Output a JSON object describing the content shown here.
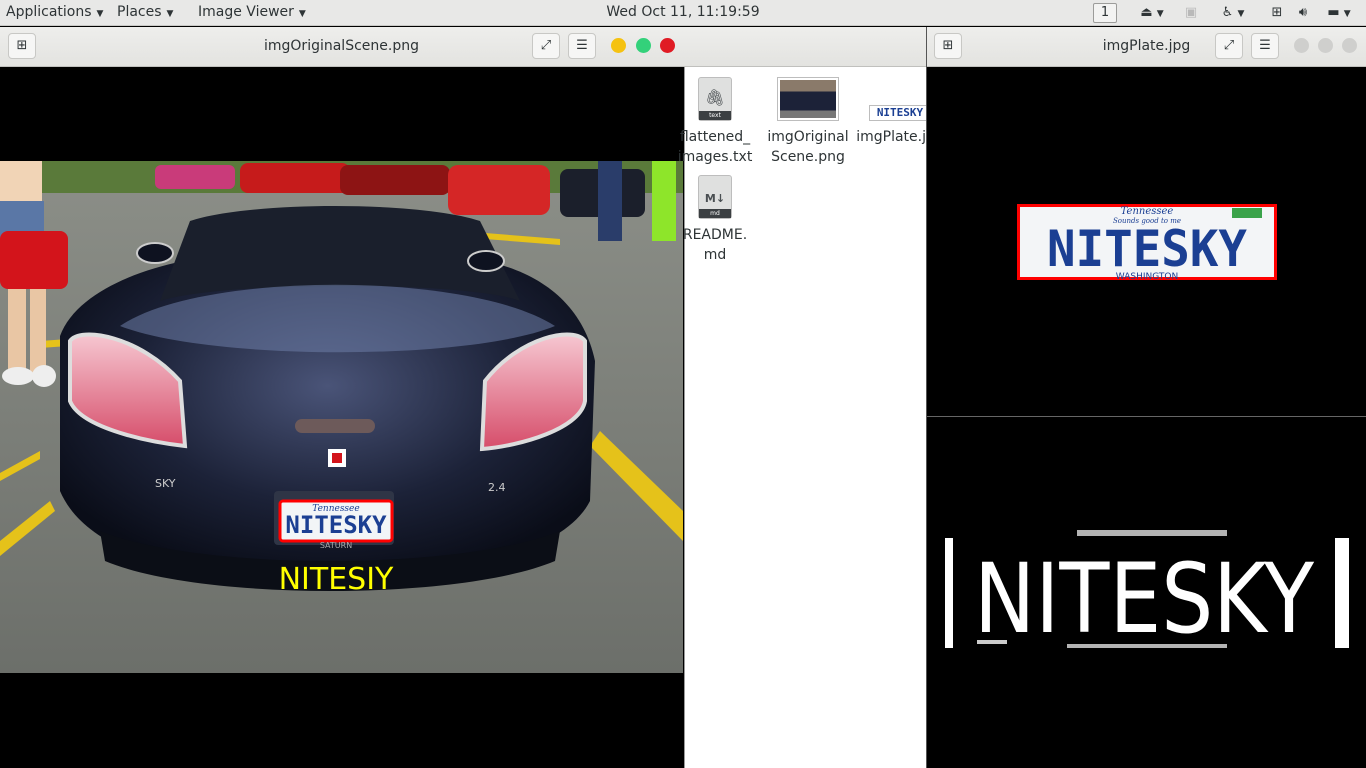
{
  "topbar": {
    "applications": "Applications",
    "places": "Places",
    "image_viewer": "Image Viewer",
    "clock": "Wed Oct 11, 11:19:59",
    "workspace": "1"
  },
  "windows": {
    "left": {
      "title": "imgOriginalScene.png",
      "overlay_text": "NITESIY",
      "plate_text": "NITESKY",
      "plate_top": "Tennessee",
      "badge": "SKY",
      "badge2": "2.4",
      "brand": "SATURN"
    },
    "right": {
      "title": "imgPlate.jpg",
      "plate_text": "NITESKY",
      "plate_top": "Tennessee",
      "plate_sub": "Sounds good to me",
      "plate_bottom": "WASHINGTON",
      "threshold_text": "NITESKY"
    }
  },
  "files": [
    {
      "name": "flattened_\nimages.txt",
      "line1": "flattened_",
      "line2": "images.txt",
      "badge": "text"
    },
    {
      "name": "imgOriginalScene.png",
      "line1": "imgOriginal",
      "line2": "Scene.png"
    },
    {
      "name": "imgPlate.jpg",
      "line1": "imgPlate.jpg",
      "thumb_text": "NITESKY"
    },
    {
      "name": "README.md",
      "line1": "README.",
      "line2": "md",
      "badge": "md",
      "glyph": "M↓"
    }
  ],
  "colors": {
    "panel": "#e8e8e7",
    "plate_blue": "#1b3f93",
    "overlay_yellow": "#ffff00",
    "detect_red": "#ff0000"
  }
}
